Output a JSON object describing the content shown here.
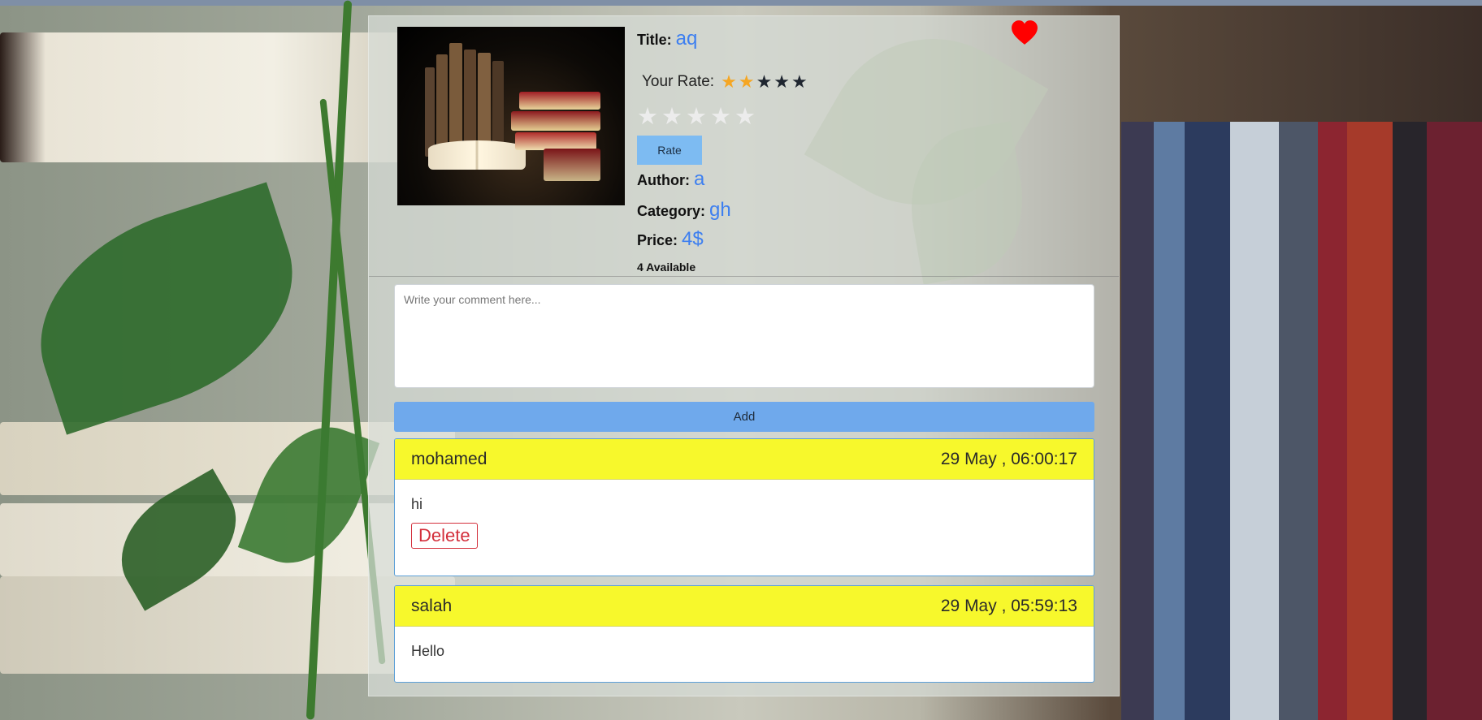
{
  "book": {
    "title_label": "Title:",
    "title": "aq",
    "your_rate_label": "Your Rate:",
    "your_rate_value": 2,
    "your_rate_max": 5,
    "rate_stars_empty": 5,
    "rate_button": "Rate",
    "author_label": "Author:",
    "author": "a",
    "category_label": "Category:",
    "category": "gh",
    "price_label": "Price:",
    "price": "4$",
    "availability": "4 Available",
    "favorite_icon": "heart-icon",
    "favorite_color": "#ff0000"
  },
  "comment_form": {
    "placeholder": "Write your comment here...",
    "value": "",
    "add_button": "Add"
  },
  "comments": [
    {
      "user": "mohamed",
      "date": "29 May , 06:00:17",
      "text": "hi",
      "delete_label": "Delete"
    },
    {
      "user": "salah",
      "date": "29 May , 05:59:13",
      "text": "Hello"
    }
  ],
  "colors": {
    "accent": "#3d7ff0",
    "rate_button": "#7dbbf2",
    "add_button": "#6fa9ec",
    "comment_header": "#f7f82c",
    "delete": "#d32f3b",
    "star_filled": "#f5a623",
    "star_empty_dark": "#1f2630"
  }
}
